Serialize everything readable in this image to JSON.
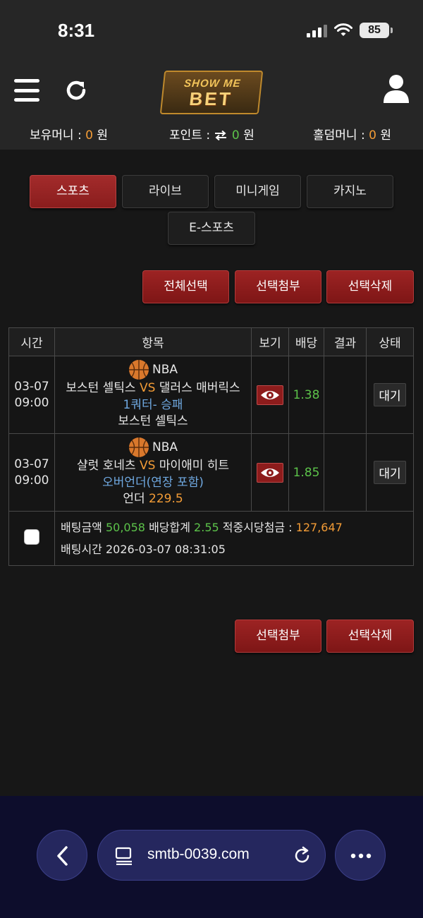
{
  "status_bar": {
    "time": "8:31",
    "battery": "85"
  },
  "header": {
    "logo_top": "SHOW ME",
    "logo_bottom": "BET"
  },
  "wallet": {
    "holding_label": "보유머니 :",
    "holding_value": "0",
    "holding_unit": "원",
    "points_label": "포인트 :",
    "points_value": "0",
    "points_unit": "원",
    "holdem_label": "홀덤머니 :",
    "holdem_value": "0",
    "holdem_unit": "원"
  },
  "nav": {
    "sports": "스포츠",
    "live": "라이브",
    "minigame": "미니게임",
    "casino": "카지노",
    "esports": "E-스포츠"
  },
  "actions_top": {
    "select_all": "전체선택",
    "attach_selected": "선택첨부",
    "delete_selected": "선택삭제"
  },
  "table": {
    "headers": [
      "시간",
      "항목",
      "보기",
      "배당",
      "결과",
      "상태"
    ],
    "rows": [
      {
        "date": "03-07",
        "time": "09:00",
        "league": "NBA",
        "home": "보스턴 셀틱스",
        "vs": "VS",
        "away": "댈러스 매버릭스",
        "market": "1쿼터- 승패",
        "pick_prefix": "보스턴 셀틱스",
        "pick_value": "",
        "odds": "1.38",
        "result": "",
        "status": "대기"
      },
      {
        "date": "03-07",
        "time": "09:00",
        "league": "NBA",
        "home": "샬럿 호네츠",
        "vs": "VS",
        "away": "마이애미 히트",
        "market": "오버언더(연장 포함)",
        "pick_prefix": "언더",
        "pick_value": "229.5",
        "odds": "1.85",
        "result": "",
        "status": "대기"
      }
    ],
    "summary": {
      "amount_label": "배팅금액",
      "amount_value": "50,058",
      "total_label": "배당합계",
      "total_value": "2.55",
      "payout_label": "적중시당첨금 :",
      "payout_value": "127,647",
      "time_label": "배팅시간",
      "time_value": "2026-03-07 08:31:05"
    }
  },
  "actions_bottom": {
    "attach_selected": "선택첨부",
    "delete_selected": "선택삭제"
  },
  "browser": {
    "url": "smtb-0039.com"
  },
  "colors": {
    "accent_red": "#9c2323",
    "orange": "#f39c36",
    "green": "#5cc34a",
    "blue": "#6fa8e0"
  }
}
